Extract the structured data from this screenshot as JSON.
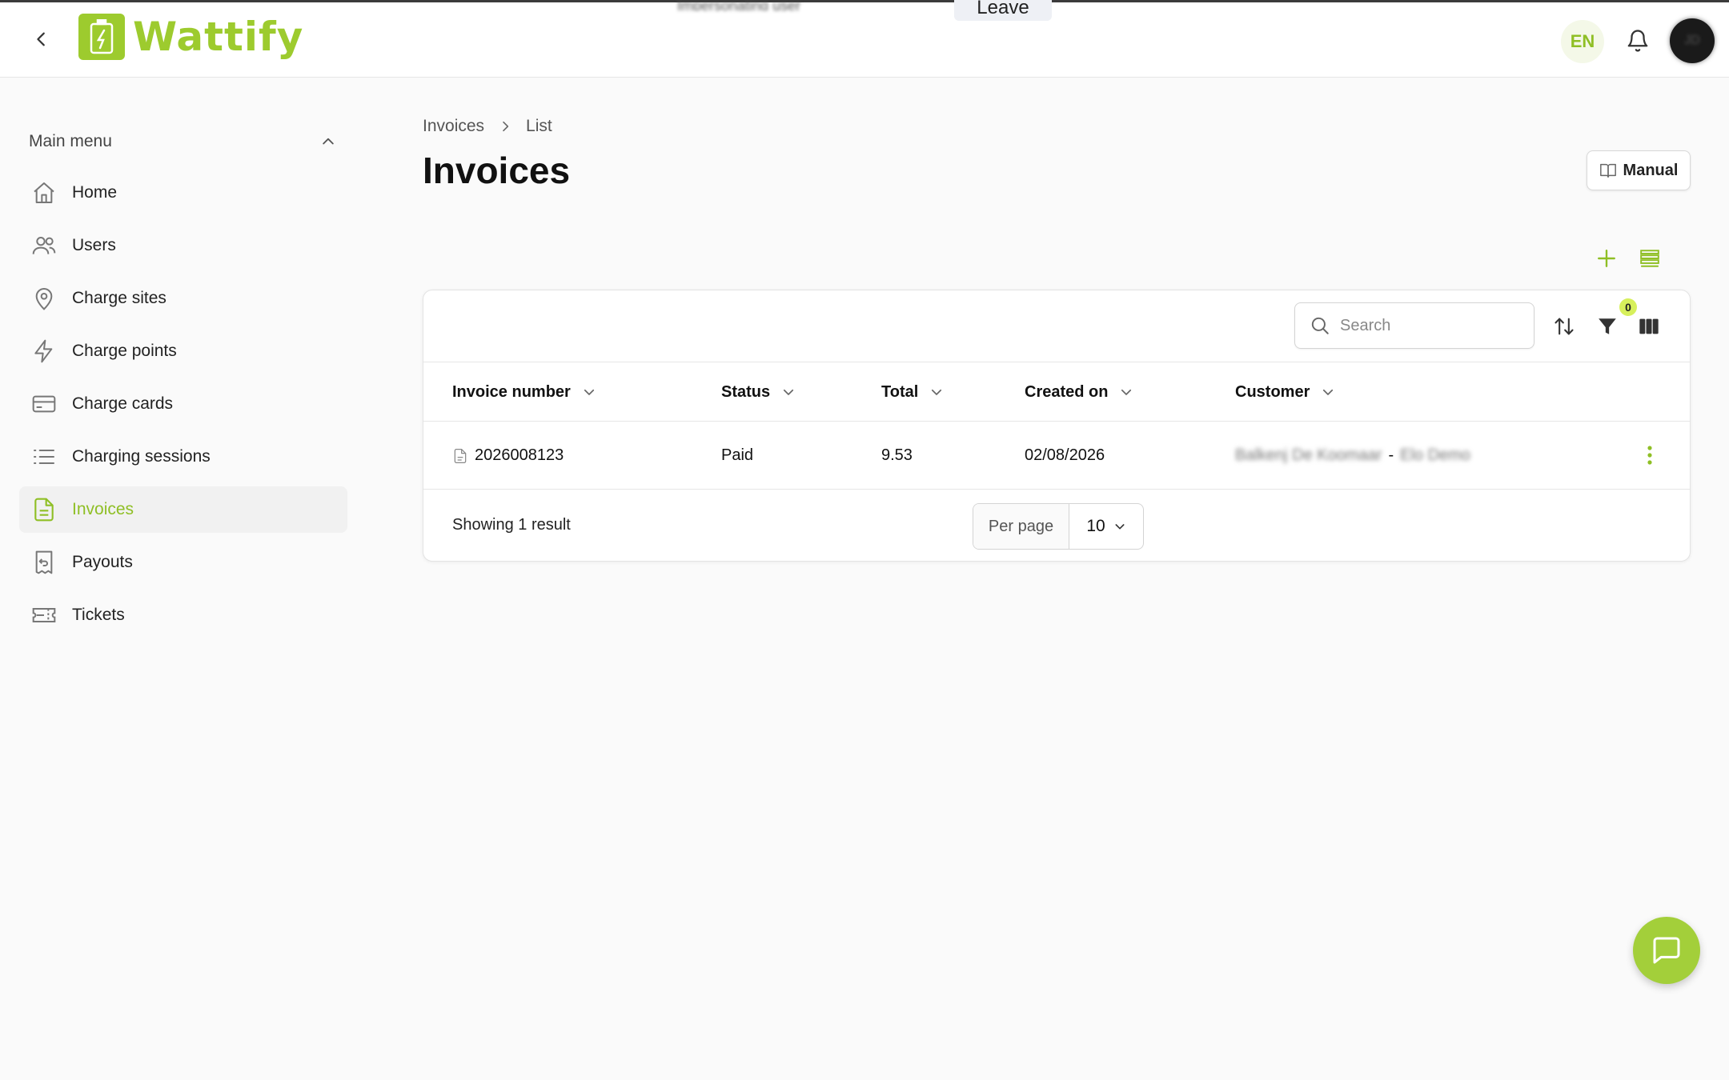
{
  "topbar": {
    "logo_text": "Wattify",
    "leave_label": "Leave",
    "banner_text": "Impersonating user",
    "lang_label": "EN",
    "avatar_initials": "JD",
    "brand_color": "#9dcb2e"
  },
  "sidebar": {
    "menu_header": "Main menu",
    "items": [
      {
        "label": "Home",
        "icon": "home-icon"
      },
      {
        "label": "Users",
        "icon": "users-icon"
      },
      {
        "label": "Charge sites",
        "icon": "map-pin-icon"
      },
      {
        "label": "Charge points",
        "icon": "lightning-icon"
      },
      {
        "label": "Charge cards",
        "icon": "credit-card-icon"
      },
      {
        "label": "Charging sessions",
        "icon": "list-icon"
      },
      {
        "label": "Invoices",
        "icon": "document-icon",
        "active": true
      },
      {
        "label": "Payouts",
        "icon": "receipt-icon"
      },
      {
        "label": "Tickets",
        "icon": "ticket-icon"
      }
    ]
  },
  "main": {
    "breadcrumb": [
      "Invoices",
      "List"
    ],
    "title": "Invoices",
    "manual_label": "Manual"
  },
  "table": {
    "search_placeholder": "Search",
    "filter_count": "0",
    "columns": [
      "Invoice number",
      "Status",
      "Total",
      "Created on",
      "Customer"
    ],
    "rows": [
      {
        "invoice_number": "2026008123",
        "status": "Paid",
        "total": "9.53",
        "created_on": "02/08/2026",
        "customer_name": "Balkenj De Koomaar",
        "customer_separator": "-",
        "customer_org": "Elo Demo"
      }
    ],
    "result_text": "Showing 1 result",
    "per_page_label": "Per page",
    "per_page_value": "10"
  }
}
